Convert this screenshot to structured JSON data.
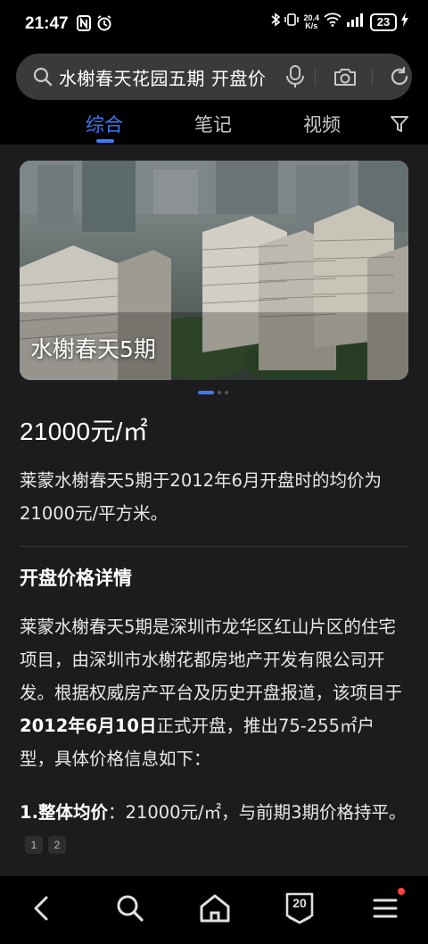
{
  "status_bar": {
    "time": "21:47",
    "net_speed_value": "20.4",
    "net_speed_unit": "K/s",
    "battery": "23"
  },
  "search": {
    "query": "水榭春天花园五期 开盘价"
  },
  "tabs": [
    {
      "label": "综合",
      "active": true
    },
    {
      "label": "笔记",
      "active": false
    },
    {
      "label": "视频",
      "active": false
    }
  ],
  "hero": {
    "caption": "水榭春天5期"
  },
  "answer": {
    "price": "21000元/㎡",
    "summary": "莱蒙水榭春天5期于2012年6月开盘时的均价为21000元/平方米。",
    "section_heading": "开盘价格详情",
    "detail_before": "莱蒙水榭春天5期是深圳市龙华区红山片区的住宅项目，由深圳市水榭花都房地产开发有限公司开发。根据权威房产平台及历史开盘报道，该项目于",
    "detail_date": "2012年6月10日",
    "detail_after": "正式开盘，推出75-255㎡户型，具体价格信息如下：",
    "item1_index": "1.",
    "item1_label": "整体均价",
    "item1_text": "：21000元/㎡，与前期3期价格持平。",
    "citations": [
      "1",
      "2"
    ]
  },
  "bottom_nav": {
    "tab_count": "20"
  },
  "colors": {
    "accent": "#3d7bf7",
    "panel": "#1c1c1e",
    "search_bg": "#3a3a3c"
  }
}
